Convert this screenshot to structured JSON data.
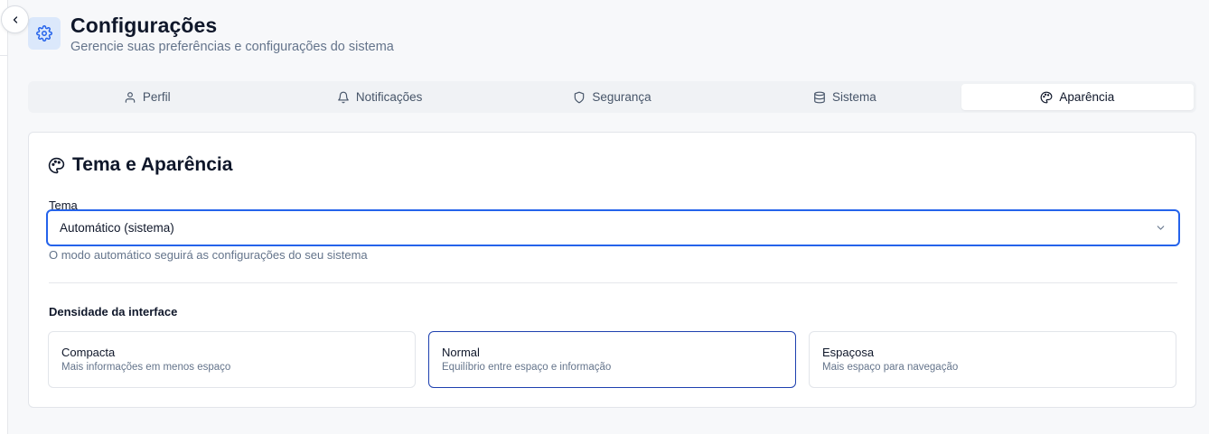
{
  "header": {
    "title": "Configurações",
    "subtitle": "Gerencie suas preferências e configurações do sistema"
  },
  "tabs": [
    {
      "label": "Perfil",
      "icon": "user-icon"
    },
    {
      "label": "Notificações",
      "icon": "bell-icon"
    },
    {
      "label": "Segurança",
      "icon": "shield-icon"
    },
    {
      "label": "Sistema",
      "icon": "database-icon"
    },
    {
      "label": "Aparência",
      "icon": "palette-icon",
      "active": true
    }
  ],
  "card": {
    "title": "Tema e Aparência",
    "theme_label": "Tema",
    "theme_value": "Automático (sistema)",
    "theme_helper": "O modo automático seguirá as configurações do seu sistema",
    "density_label": "Densidade da interface",
    "density_options": [
      {
        "title": "Compacta",
        "desc": "Mais informações em menos espaço"
      },
      {
        "title": "Normal",
        "desc": "Equilíbrio entre espaço e informação",
        "selected": true
      },
      {
        "title": "Espaçosa",
        "desc": "Mais espaço para navegação"
      }
    ]
  },
  "colors": {
    "accent": "#2563eb",
    "selected_border": "#1e40af",
    "icon_bg": "#dbe8fb"
  }
}
